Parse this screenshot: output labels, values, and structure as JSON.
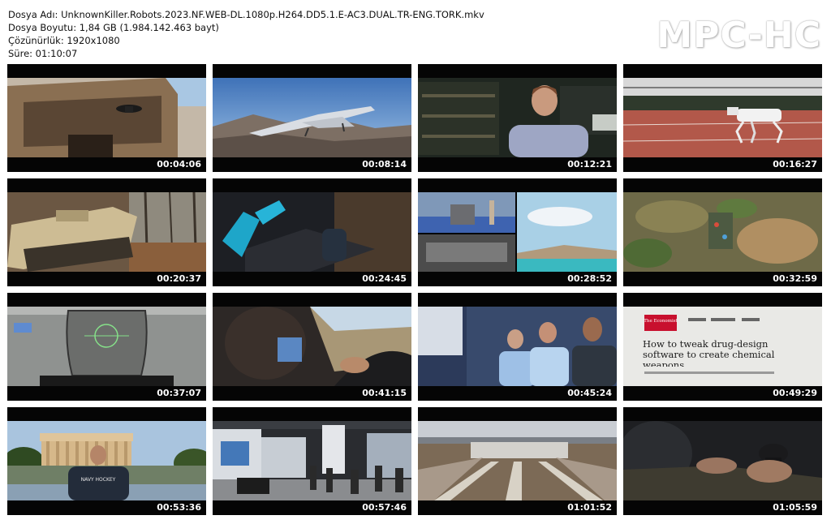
{
  "info": {
    "filename": "Dosya Adı: UnknownKiller.Robots.2023.NF.WEB-DL.1080p.H264.DD5.1.E-AC3.DUAL.TR-ENG.TORK.mkv",
    "filesize": "Dosya Boyutu: 1,84 GB (1.984.142.463 bayt)",
    "resolution": "Çözünürlük: 1920x1080",
    "duration": "Süre: 01:10:07"
  },
  "logo": "MPC-HC",
  "thumbnails": [
    {
      "time": "00:04:06",
      "scene": "drone-building"
    },
    {
      "time": "00:08:14",
      "scene": "predator-drone-sky"
    },
    {
      "time": "00:12:21",
      "scene": "man-interview-lab"
    },
    {
      "time": "00:16:27",
      "scene": "robot-dog-track"
    },
    {
      "time": "00:20:37",
      "scene": "tracked-robot-forest"
    },
    {
      "time": "00:24:45",
      "scene": "computer-monitors"
    },
    {
      "time": "00:28:52",
      "scene": "split-screen-simulation"
    },
    {
      "time": "00:32:59",
      "scene": "aerial-battle-map"
    },
    {
      "time": "00:37:07",
      "scene": "cockpit-hud"
    },
    {
      "time": "00:41:15",
      "scene": "man-driving"
    },
    {
      "time": "00:45:24",
      "scene": "three-men-meeting"
    },
    {
      "time": "00:49:29",
      "scene": "economist-article"
    },
    {
      "time": "00:53:36",
      "scene": "man-lincoln-memorial"
    },
    {
      "time": "00:57:46",
      "scene": "defense-expo"
    },
    {
      "time": "01:01:52",
      "scene": "launch-rails-desert"
    },
    {
      "time": "01:05:59",
      "scene": "hand-joystick"
    }
  ],
  "economist": {
    "brand": "The Economist",
    "headline": "How to tweak drug-design software to create chemical weapons"
  },
  "shirt_text": "NAVY HOCKEY"
}
